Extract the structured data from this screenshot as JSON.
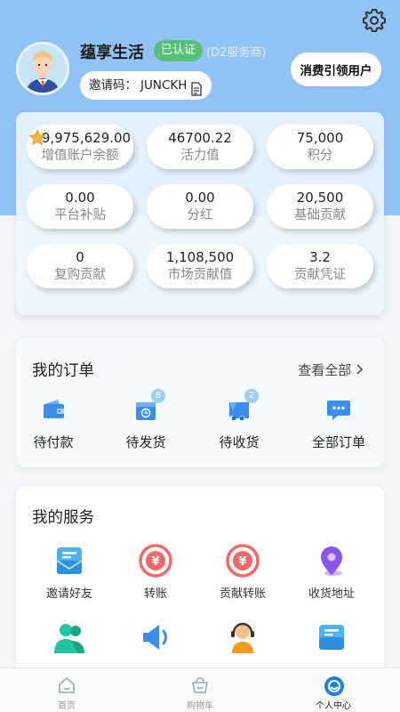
{
  "profile": {
    "name": "蕴享生活",
    "verified_label": "已认证",
    "role_tag": "(D2服务商)",
    "invite_code_label": "邀请码：",
    "invite_code": "JUNCKH",
    "guide_button": "消费引领用户"
  },
  "stats": [
    {
      "value": "9,975,629.00",
      "label": "增值账户余额"
    },
    {
      "value": "46700.22",
      "label": "活力值"
    },
    {
      "value": "75,000",
      "label": "积分"
    },
    {
      "value": "0.00",
      "label": "平台补贴"
    },
    {
      "value": "0.00",
      "label": "分红"
    },
    {
      "value": "20,500",
      "label": "基础贡献"
    },
    {
      "value": "0",
      "label": "复购贡献"
    },
    {
      "value": "1,108,500",
      "label": "市场贡献值"
    },
    {
      "value": "3.2",
      "label": "贡献凭证"
    }
  ],
  "orders": {
    "title": "我的订单",
    "see_all": "查看全部",
    "items": [
      {
        "label": "待付款",
        "icon": "wallet-icon",
        "badge": ""
      },
      {
        "label": "待发货",
        "icon": "package-icon",
        "badge": "8"
      },
      {
        "label": "待收货",
        "icon": "truck-icon",
        "badge": "2"
      },
      {
        "label": "全部订单",
        "icon": "chat-icon",
        "badge": ""
      }
    ]
  },
  "services": {
    "title": "我的服务",
    "items": [
      {
        "label": "邀请好友",
        "icon": "invite-icon"
      },
      {
        "label": "转账",
        "icon": "transfer-icon"
      },
      {
        "label": "贡献转账",
        "icon": "contribution-transfer-icon"
      },
      {
        "label": "收货地址",
        "icon": "location-icon"
      },
      {
        "label": "",
        "icon": "team-icon"
      },
      {
        "label": "",
        "icon": "announcement-icon"
      },
      {
        "label": "",
        "icon": "customer-service-icon"
      },
      {
        "label": "",
        "icon": "message-icon"
      }
    ]
  },
  "tabbar": [
    {
      "label": "首页",
      "icon": "home-icon",
      "active": false
    },
    {
      "label": "购物车",
      "icon": "cart-icon",
      "active": false
    },
    {
      "label": "个人中心",
      "icon": "profile-icon",
      "active": true
    }
  ],
  "colors": {
    "header_bg": "#92c3f5",
    "verified_green": "#57c07a",
    "accent_blue": "#3a8ef0",
    "transfer_red": "#f06a6a"
  }
}
